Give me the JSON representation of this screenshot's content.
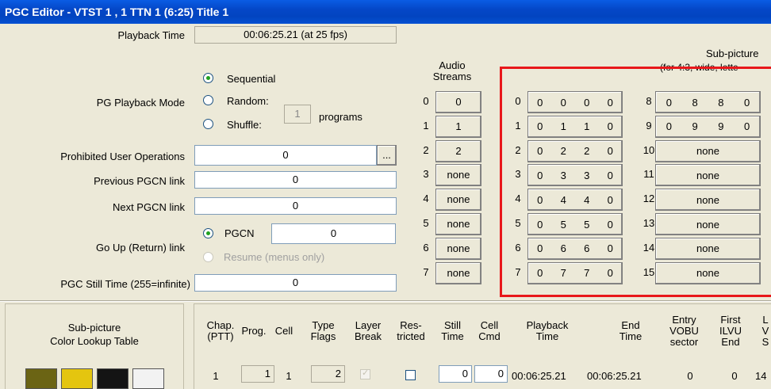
{
  "window": {
    "title": "PGC Editor - VTST 1 , 1   TTN 1  (6:25)  Title 1"
  },
  "form": {
    "playback_time_label": "Playback Time",
    "playback_time_value": "00:06:25.21 (at 25 fps)",
    "pg_mode_label": "PG Playback Mode",
    "mode_sequential": "Sequential",
    "mode_random": "Random:",
    "mode_shuffle": "Shuffle:",
    "programs_value": "1",
    "programs_label": "programs",
    "prohibited_label": "Prohibited User Operations",
    "prohibited_value": "0",
    "ellipsis": "...",
    "prev_label": "Previous PGCN link",
    "prev_value": "0",
    "next_label": "Next PGCN link",
    "next_value": "0",
    "goup_label": "Go Up (Return) link",
    "goup_pgcn": "PGCN",
    "goup_value": "0",
    "goup_resume": "Resume (menus only)",
    "still_label": "PGC Still Time (255=infinite)",
    "still_value": "0"
  },
  "audio": {
    "title_line1": "Audio",
    "title_line2": "Streams",
    "rows": [
      {
        "index": "0",
        "value": "0"
      },
      {
        "index": "1",
        "value": "1"
      },
      {
        "index": "2",
        "value": "2"
      },
      {
        "index": "3",
        "value": "none"
      },
      {
        "index": "4",
        "value": "none"
      },
      {
        "index": "5",
        "value": "none"
      },
      {
        "index": "6",
        "value": "none"
      },
      {
        "index": "7",
        "value": "none"
      }
    ]
  },
  "subpicture": {
    "title": "Sub-picture",
    "subtitle": "(for 4:3, wide, lette",
    "highlight_color": "#e8171a",
    "left": [
      {
        "index": "0",
        "values": [
          "0",
          "0",
          "0",
          "0"
        ]
      },
      {
        "index": "1",
        "values": [
          "0",
          "1",
          "1",
          "0"
        ]
      },
      {
        "index": "2",
        "values": [
          "0",
          "2",
          "2",
          "0"
        ]
      },
      {
        "index": "3",
        "values": [
          "0",
          "3",
          "3",
          "0"
        ]
      },
      {
        "index": "4",
        "values": [
          "0",
          "4",
          "4",
          "0"
        ]
      },
      {
        "index": "5",
        "values": [
          "0",
          "5",
          "5",
          "0"
        ]
      },
      {
        "index": "6",
        "values": [
          "0",
          "6",
          "6",
          "0"
        ]
      },
      {
        "index": "7",
        "values": [
          "0",
          "7",
          "7",
          "0"
        ]
      }
    ],
    "right": [
      {
        "index": "8",
        "values": [
          "0",
          "8",
          "8",
          "0"
        ]
      },
      {
        "index": "9",
        "values": [
          "0",
          "9",
          "9",
          "0"
        ]
      },
      {
        "index": "10",
        "values": [
          "none"
        ]
      },
      {
        "index": "11",
        "values": [
          "none"
        ]
      },
      {
        "index": "12",
        "values": [
          "none"
        ]
      },
      {
        "index": "13",
        "values": [
          "none"
        ]
      },
      {
        "index": "14",
        "values": [
          "none"
        ]
      },
      {
        "index": "15",
        "values": [
          "none"
        ]
      }
    ]
  },
  "clut": {
    "title_line1": "Sub-picture",
    "title_line2": "Color Lookup Table",
    "swatches": [
      "#6b6414",
      "#e4c50f",
      "#141414",
      "#f2f2f2"
    ]
  },
  "cells": {
    "headers": [
      {
        "l1": "Chap.",
        "l2": "(PTT)"
      },
      {
        "l1": "Prog.",
        "l2": ""
      },
      {
        "l1": "Cell",
        "l2": ""
      },
      {
        "l1": "Type",
        "l2": "Flags"
      },
      {
        "l1": "Layer",
        "l2": "Break"
      },
      {
        "l1": "Res-",
        "l2": "tricted"
      },
      {
        "l1": "Still",
        "l2": "Time"
      },
      {
        "l1": "Cell",
        "l2": "Cmd"
      },
      {
        "l1": "Playback",
        "l2": "Time"
      },
      {
        "l1": "End",
        "l2": "Time"
      },
      {
        "l1": "Entry",
        "l2": "VOBU",
        "l3": "sector"
      },
      {
        "l1": "First",
        "l2": "ILVU",
        "l3": "End"
      },
      {
        "l1": "L",
        "l2": "V",
        "l3": "S"
      }
    ],
    "row": {
      "chap": "1",
      "prog": "1",
      "cell": "1",
      "type": "2",
      "still": "0",
      "cmd": "0",
      "playback": "00:06:25.21",
      "end": "00:06:25.21",
      "entry": "0",
      "first": "0",
      "last": "14"
    }
  }
}
